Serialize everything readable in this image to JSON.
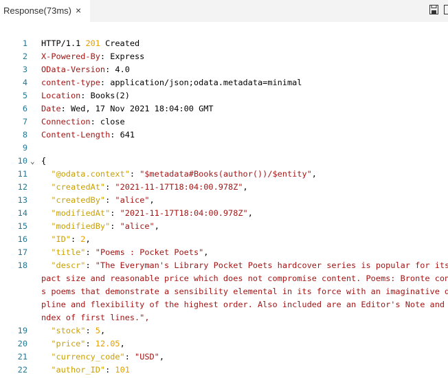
{
  "tab": {
    "title": "Response(73ms)",
    "close": "×"
  },
  "toolbar": {
    "save_icon": "save-icon",
    "split_icon": "split-editor-icon"
  },
  "response": {
    "status_line": {
      "proto": "HTTP/1.1 ",
      "code": "201",
      "text": " Created"
    },
    "headers": [
      {
        "name": "X-Powered-By",
        "value": "Express"
      },
      {
        "name": "OData-Version",
        "value": "4.0"
      },
      {
        "name": "content-type",
        "value": "application/json;odata.metadata=minimal"
      },
      {
        "name": "Location",
        "value": "Books(2)"
      },
      {
        "name": "Date",
        "value": "Wed, 17 Nov 2021 18:04:00 GMT"
      },
      {
        "name": "Connection",
        "value": "close"
      },
      {
        "name": "Content-Length",
        "value": "641"
      }
    ],
    "body_open": "{",
    "fields": [
      {
        "key": "\"@odata.context\"",
        "value": "\"$metadata#Books(author())/$entity\"",
        "type": "str"
      },
      {
        "key": "\"createdAt\"",
        "value": "\"2021-11-17T18:04:00.978Z\"",
        "type": "str"
      },
      {
        "key": "\"createdBy\"",
        "value": "\"alice\"",
        "type": "str"
      },
      {
        "key": "\"modifiedAt\"",
        "value": "\"2021-11-17T18:04:00.978Z\"",
        "type": "str"
      },
      {
        "key": "\"modifiedBy\"",
        "value": "\"alice\"",
        "type": "str"
      },
      {
        "key": "\"ID\"",
        "value": "2",
        "type": "num"
      },
      {
        "key": "\"title\"",
        "value": "\"Poems : Pocket Poets\"",
        "type": "str"
      },
      {
        "key": "\"descr\"",
        "value": "\"The Everyman's Library Pocket Poets hardcover series is popular for its",
        "type": "str"
      }
    ],
    "descr_wrap": [
      "pact size and reasonable price which does not compromise content. Poems: Bronte con",
      "s poems that demonstrate a sensibility elemental in its force with an imaginative d",
      "pline and flexibility of the highest order. Also included are an Editor's Note and",
      "ndex of first lines.\","
    ],
    "fields_after": [
      {
        "key": "\"stock\"",
        "value": "5",
        "type": "num"
      },
      {
        "key": "\"price\"",
        "value": "12.05",
        "type": "num"
      },
      {
        "key": "\"currency_code\"",
        "value": "\"USD\"",
        "type": "str"
      },
      {
        "key": "\"author_ID\"",
        "value": "101",
        "type": "num",
        "last": true
      }
    ],
    "line_numbers": [
      "1",
      "2",
      "3",
      "4",
      "5",
      "6",
      "7",
      "8",
      "9",
      "10",
      "11",
      "12",
      "13",
      "14",
      "15",
      "16",
      "17",
      "18",
      "19",
      "20",
      "21",
      "22"
    ],
    "fold_glyph": "⌄"
  },
  "colors": {
    "line_number": "#237893",
    "header_name": "#a31515",
    "json_key": "#c9a000",
    "json_string": "#a31515",
    "json_number": "#e6a000"
  }
}
